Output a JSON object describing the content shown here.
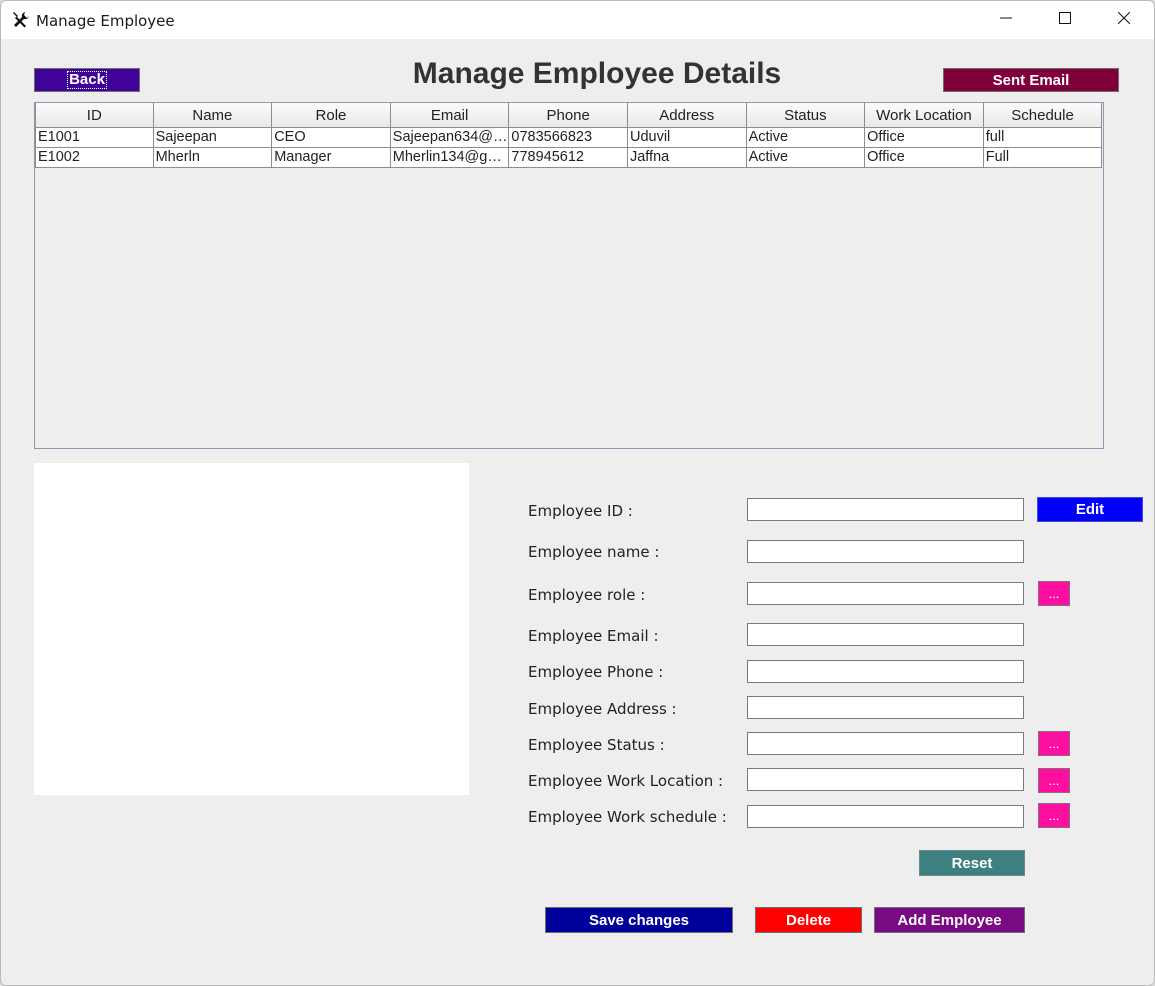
{
  "window": {
    "title": "Manage Employee",
    "icon": "tools-icon"
  },
  "header": {
    "back_label": "Back",
    "title": "Manage Employee Details",
    "email_label": "Sent Email"
  },
  "table": {
    "columns": [
      "ID",
      "Name",
      "Role",
      "Email",
      "Phone",
      "Address",
      "Status",
      "Work Location",
      "Schedule"
    ],
    "rows": [
      [
        "E1001",
        "Sajeepan",
        "CEO",
        "Sajeepan634@g...",
        "0783566823",
        "Uduvil",
        "Active",
        "Office",
        "full"
      ],
      [
        "E1002",
        "Mherln",
        "Manager",
        "Mherlin134@gm...",
        "778945612",
        "Jaffna",
        "Active",
        "Office",
        "Full"
      ]
    ]
  },
  "form": {
    "labels": {
      "id": "Employee ID :",
      "name": "Employee name :",
      "role": "Employee role :",
      "email": "Employee Email :",
      "phone": "Employee Phone :",
      "address": "Employee Address :",
      "status": "Employee Status :",
      "location": "Employee Work Location :",
      "schedule": "Employee Work schedule :"
    },
    "values": {
      "id": "",
      "name": "",
      "role": "",
      "email": "",
      "phone": "",
      "address": "",
      "status": "",
      "location": "",
      "schedule": ""
    },
    "dots_label": "...",
    "edit_label": "Edit",
    "reset_label": "Reset"
  },
  "actions": {
    "save_label": "Save changes",
    "delete_label": "Delete",
    "add_label": "Add Employee"
  },
  "colors": {
    "back": "#3f0399",
    "email": "#80003a",
    "edit": "#0000ff",
    "dots": "#ff0fa0",
    "reset": "#3e8080",
    "save": "#00009a",
    "delete": "#ff0000",
    "add": "#7a0a82"
  }
}
